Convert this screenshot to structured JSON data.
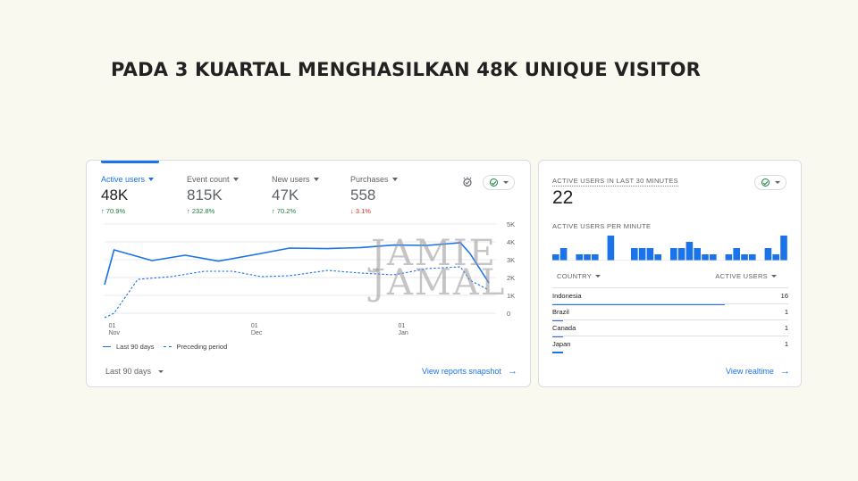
{
  "headline": "PADA 3 KUARTAL MENGHASILKAN 48K UNIQUE VISITOR",
  "overview": {
    "metrics": [
      {
        "label": "Active users",
        "value": "48K",
        "change": "70.9%",
        "direction": "up",
        "active": true
      },
      {
        "label": "Event count",
        "value": "815K",
        "change": "232.8%",
        "direction": "up",
        "active": false
      },
      {
        "label": "New users",
        "value": "47K",
        "change": "70.2%",
        "direction": "up",
        "active": false
      },
      {
        "label": "Purchases",
        "value": "558",
        "change": "3.1%",
        "direction": "down",
        "active": false
      }
    ],
    "arrow_up": "↑",
    "arrow_down": "↓",
    "date_range": "Last 90 days",
    "link_label": "View reports snapshot",
    "link_arrow": "→",
    "watermark": [
      "JAMIE",
      "JAMAL"
    ]
  },
  "chart_data": {
    "type": "line",
    "x_tick_labels": [
      {
        "top": "01",
        "bottom": "Nov",
        "day": 0
      },
      {
        "top": "01",
        "bottom": "Dec",
        "day": 30
      },
      {
        "top": "01",
        "bottom": "Jan",
        "day": 61
      }
    ],
    "y_ticks": [
      {
        "label": "5K",
        "value": 5000
      },
      {
        "label": "4K",
        "value": 4000
      },
      {
        "label": "3K",
        "value": 3000
      },
      {
        "label": "2K",
        "value": 2000
      },
      {
        "label": "1K",
        "value": 1000
      },
      {
        "label": "0",
        "value": 0
      }
    ],
    "ylim": [
      0,
      5000
    ],
    "grid": true,
    "series": [
      {
        "name": "Last 90 days",
        "style": "solid",
        "color": "#1a73e8",
        "x": [
          -2,
          0,
          8,
          15,
          22,
          30,
          37,
          45,
          52,
          59,
          66,
          73,
          75,
          79
        ],
        "y": [
          1600,
          3550,
          2950,
          3250,
          2920,
          3300,
          3650,
          3620,
          3680,
          3820,
          3800,
          3950,
          3350,
          1700
        ]
      },
      {
        "name": "Preceding period",
        "style": "dashed",
        "color": "#1a73e8",
        "x": [
          -2,
          0,
          5,
          12,
          19,
          25,
          31,
          37,
          45,
          52,
          59,
          66,
          73,
          75,
          79
        ],
        "y": [
          -500,
          0,
          1900,
          2050,
          2350,
          2350,
          2050,
          2100,
          2400,
          2250,
          2150,
          2500,
          2600,
          1850,
          1300
        ]
      }
    ]
  },
  "realtime": {
    "title": "ACTIVE USERS IN LAST 30 MINUTES",
    "count": "22",
    "per_minute_label": "ACTIVE USERS PER MINUTE",
    "per_minute": [
      1,
      2,
      0,
      1,
      1,
      1,
      0,
      4,
      0,
      0,
      2,
      2,
      2,
      1,
      0,
      2,
      2,
      3,
      2,
      1,
      1,
      0,
      1,
      2,
      1,
      1,
      0,
      2,
      1,
      4
    ],
    "col_country": "COUNTRY",
    "col_users": "ACTIVE USERS",
    "rows": [
      {
        "country": "Indonesia",
        "users": "16",
        "share": 0.73
      },
      {
        "country": "Brazil",
        "users": "1",
        "share": 0.046
      },
      {
        "country": "Canada",
        "users": "1",
        "share": 0.046
      },
      {
        "country": "Japan",
        "users": "1",
        "share": 0.046
      }
    ],
    "link_label": "View realtime",
    "link_arrow": "→"
  },
  "colors": {
    "accent": "#1a73e8",
    "positive": "#188038",
    "negative": "#d93025"
  }
}
